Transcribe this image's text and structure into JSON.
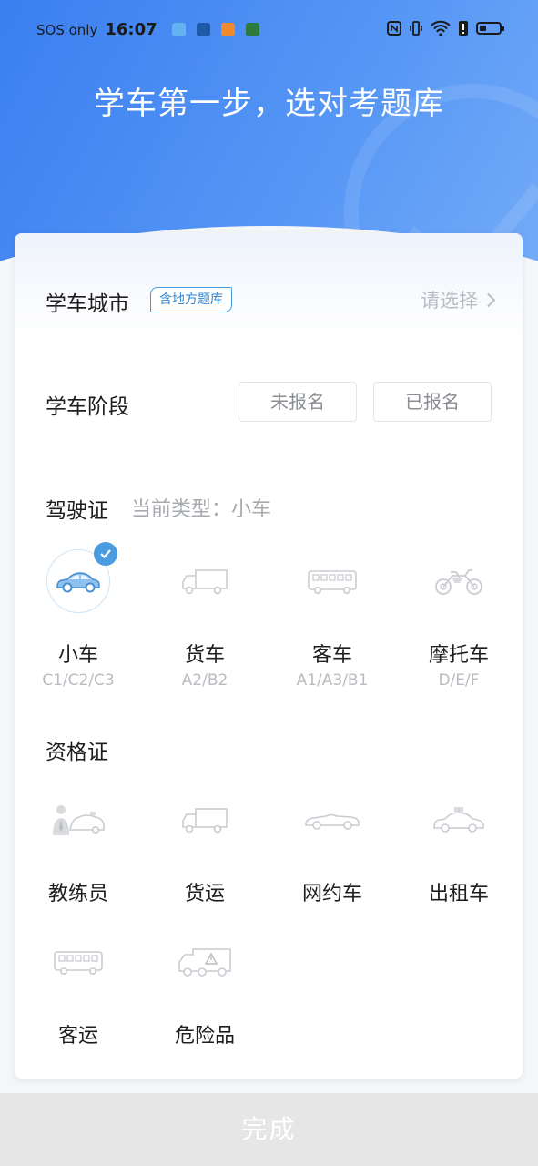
{
  "status_bar": {
    "carrier": "SOS only",
    "time": "16:07"
  },
  "header": {
    "title": "学车第一步，选对考题库"
  },
  "city": {
    "label": "学车城市",
    "chip": "含地方题库",
    "placeholder": "请选择"
  },
  "stage": {
    "label": "学车阶段",
    "options": [
      "未报名",
      "已报名"
    ]
  },
  "license": {
    "label": "驾驶证",
    "current_type": "当前类型：小车",
    "items": [
      {
        "name": "小车",
        "code": "C1/C2/C3",
        "icon": "car-icon",
        "selected": true
      },
      {
        "name": "货车",
        "code": "A2/B2",
        "icon": "truck-icon",
        "selected": false
      },
      {
        "name": "客车",
        "code": "A1/A3/B1",
        "icon": "bus-icon",
        "selected": false
      },
      {
        "name": "摩托车",
        "code": "D/E/F",
        "icon": "motorcycle-icon",
        "selected": false
      }
    ]
  },
  "qualification": {
    "label": "资格证",
    "items": [
      {
        "name": "教练员",
        "icon": "coach-icon"
      },
      {
        "name": "货运",
        "icon": "freight-truck-icon"
      },
      {
        "name": "网约车",
        "icon": "convertible-car-icon"
      },
      {
        "name": "出租车",
        "icon": "taxi-icon"
      },
      {
        "name": "客运",
        "icon": "passenger-bus-icon"
      },
      {
        "name": "危险品",
        "icon": "hazmat-truck-icon"
      }
    ]
  },
  "footer": {
    "done_label": "完成"
  },
  "colors": {
    "header_gradient_start": "#3b7ff0",
    "header_gradient_end": "#78aef8",
    "accent": "#4a9be0",
    "muted_text": "#b9bcc1",
    "disabled_button": "#e6e6e6"
  }
}
